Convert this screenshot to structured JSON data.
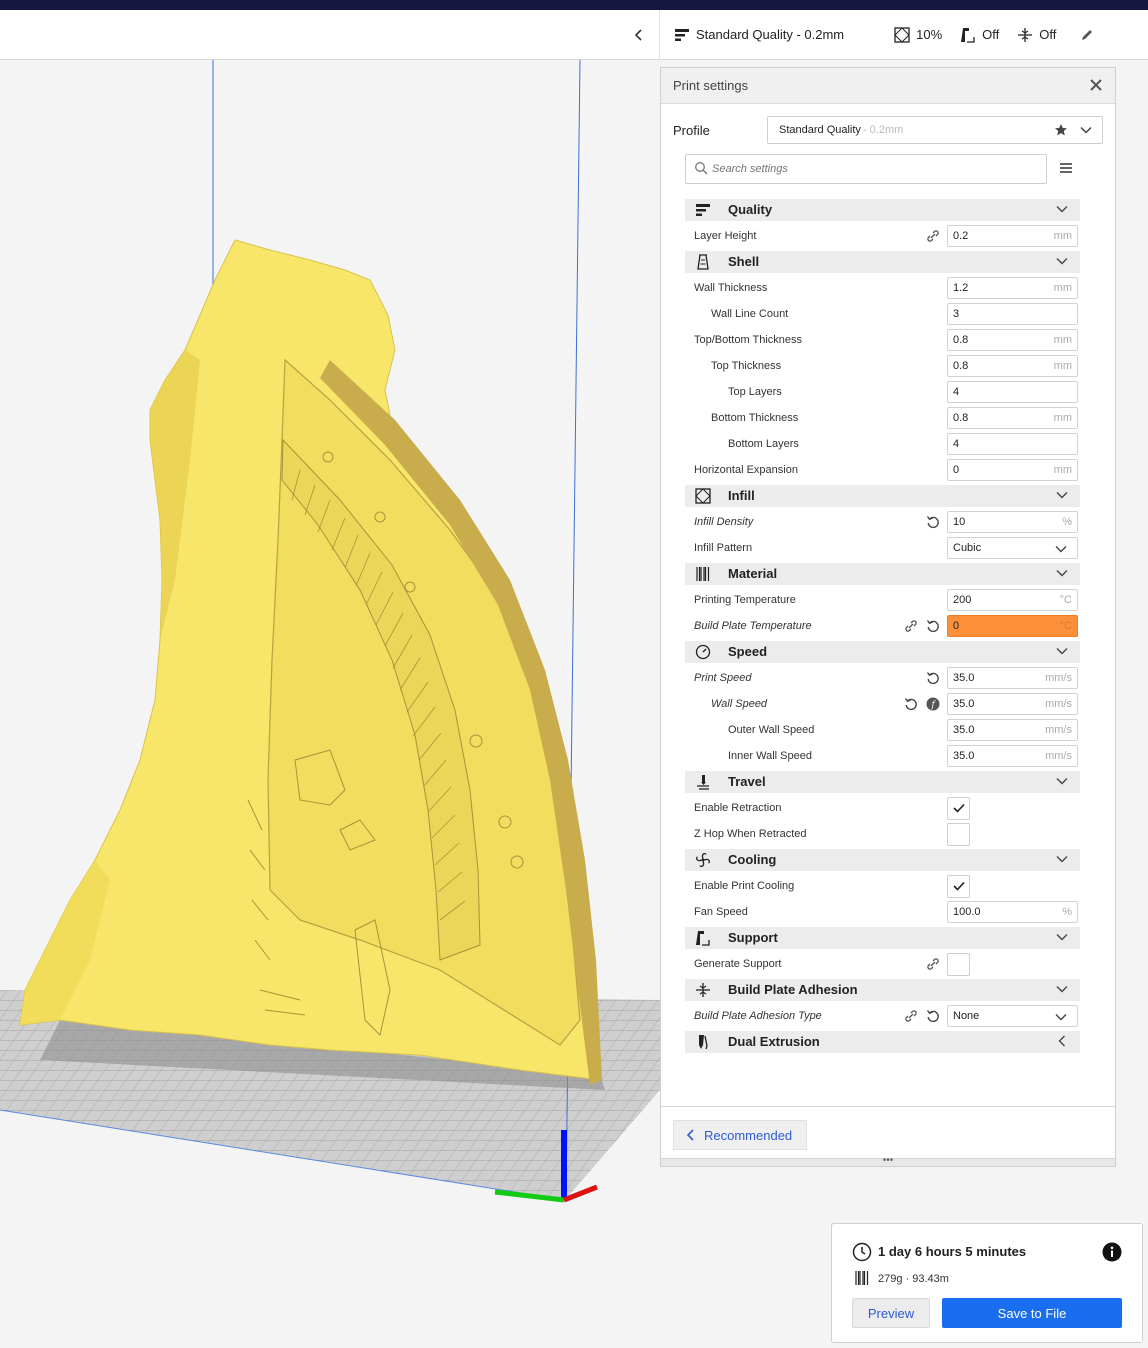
{
  "header": {
    "profile_label": "Standard Quality - 0.2mm",
    "infill_value": "10%",
    "support_value": "Off",
    "adhesion_value": "Off",
    "icons": [
      "profile-icon",
      "infill-icon",
      "support-icon",
      "adhesion-icon",
      "edit-icon",
      "collapse-chevron-icon"
    ]
  },
  "panel": {
    "title": "Print settings",
    "profile_label": "Profile",
    "profile_name": "Standard Quality",
    "profile_sub": " - 0.2mm",
    "search_placeholder": "Search settings",
    "recommended_label": "Recommended",
    "handle_label": "•••"
  },
  "categories": {
    "quality": {
      "label": "Quality",
      "rows": [
        {
          "label": "Layer Height",
          "value": "0.2",
          "unit": "mm"
        }
      ]
    },
    "shell": {
      "label": "Shell",
      "rows": [
        {
          "label": "Wall Thickness",
          "value": "1.2",
          "unit": "mm"
        },
        {
          "label": "Wall Line Count",
          "value": "3",
          "unit": ""
        },
        {
          "label": "Top/Bottom Thickness",
          "value": "0.8",
          "unit": "mm"
        },
        {
          "label": "Top Thickness",
          "value": "0.8",
          "unit": "mm"
        },
        {
          "label": "Top Layers",
          "value": "4",
          "unit": ""
        },
        {
          "label": "Bottom Thickness",
          "value": "0.8",
          "unit": "mm"
        },
        {
          "label": "Bottom Layers",
          "value": "4",
          "unit": ""
        },
        {
          "label": "Horizontal Expansion",
          "value": "0",
          "unit": "mm"
        }
      ]
    },
    "infill": {
      "label": "Infill",
      "rows": [
        {
          "label": "Infill Density",
          "value": "10",
          "unit": "%"
        },
        {
          "label": "Infill Pattern",
          "value": "Cubic",
          "unit": ""
        }
      ]
    },
    "material": {
      "label": "Material",
      "rows": [
        {
          "label": "Printing Temperature",
          "value": "200",
          "unit": "°C"
        },
        {
          "label": "Build Plate Temperature",
          "value": "0",
          "unit": "°C"
        }
      ]
    },
    "speed": {
      "label": "Speed",
      "rows": [
        {
          "label": "Print Speed",
          "value": "35.0",
          "unit": "mm/s"
        },
        {
          "label": "Wall Speed",
          "value": "35.0",
          "unit": "mm/s"
        },
        {
          "label": "Outer Wall Speed",
          "value": "35.0",
          "unit": "mm/s"
        },
        {
          "label": "Inner Wall Speed",
          "value": "35.0",
          "unit": "mm/s"
        }
      ]
    },
    "travel": {
      "label": "Travel",
      "rows": [
        {
          "label": "Enable Retraction",
          "checked": true
        },
        {
          "label": "Z Hop When Retracted",
          "checked": false
        }
      ]
    },
    "cooling": {
      "label": "Cooling",
      "rows": [
        {
          "label": "Enable Print Cooling",
          "checked": true
        },
        {
          "label": "Fan Speed",
          "value": "100.0",
          "unit": "%"
        }
      ]
    },
    "support": {
      "label": "Support",
      "rows": [
        {
          "label": "Generate Support",
          "checked": false
        }
      ]
    },
    "adhesion": {
      "label": "Build Plate Adhesion",
      "rows": [
        {
          "label": "Build Plate Adhesion Type",
          "value": "None",
          "unit": ""
        }
      ]
    },
    "dual": {
      "label": "Dual Extrusion"
    }
  },
  "print_info": {
    "time": "1 day 6 hours 5 minutes",
    "material": "279g · 93.43m",
    "preview_label": "Preview",
    "save_label": "Save to File"
  },
  "colors": {
    "accent_blue": "#196ef0",
    "link_blue": "#2d5cd1",
    "error_orange": "#fb8f3a",
    "model_yellow": "#f7e66a",
    "header_dark": "#161641"
  }
}
